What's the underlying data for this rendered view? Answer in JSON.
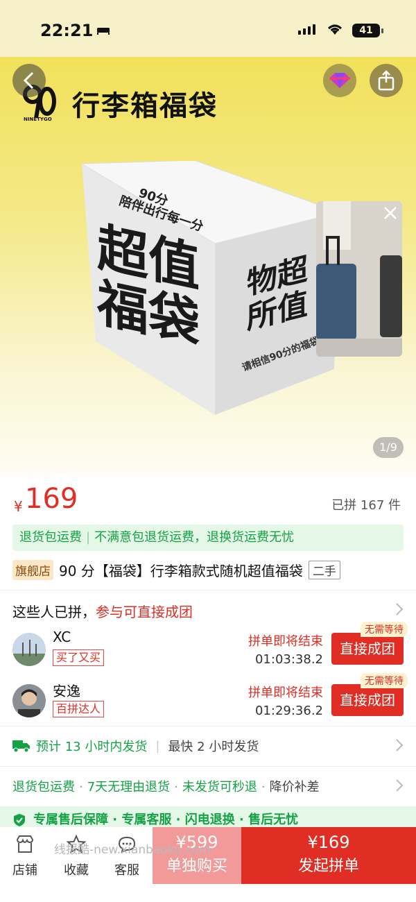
{
  "status_bar": {
    "time": "22:21",
    "battery": "41"
  },
  "hero": {
    "logo_text": "NINETYGO",
    "banner_title": "行李箱福袋",
    "cube_line1": "90分",
    "cube_line2": "陪伴出行每一分",
    "cube_big_1": "超值",
    "cube_big_2": "福袋",
    "cube_side_1": "物超",
    "cube_side_2": "所值",
    "cube_small": "请相信90分的福袋",
    "image_counter": "1/9"
  },
  "product": {
    "currency": "¥",
    "price": "169",
    "sold": "已拼 167 件",
    "return_banner": [
      "退货包运费",
      "不满意包退货运费，退换货运费无忧"
    ],
    "store_tag": "旗舰店",
    "title": "90 分【福袋】行李箱款式随机超值福袋",
    "condition_tag": "二手"
  },
  "group": {
    "heading": "这些人已拼，",
    "heading_red": "参与可直接成团",
    "members": [
      {
        "name": "XC",
        "tag": "买了又买",
        "status": "拼单即将结束",
        "timer": "01:03:38.2",
        "badge": "无需等待",
        "button": "直接成团"
      },
      {
        "name": "安逸",
        "tag": "百拼达人",
        "status": "拼单即将结束",
        "timer": "01:29:36.2",
        "badge": "无需等待",
        "button": "直接成团"
      }
    ]
  },
  "shipping": {
    "estimate": "预计 13 小时内发货",
    "fastest": "最快 2 小时发货"
  },
  "services": {
    "items": [
      "退货包运费",
      "7天无理由退货",
      "未发货可秒退"
    ],
    "extra": "降价补差"
  },
  "guarantee": {
    "text": "专属售后保障 · 专属客服 · 闪电退换 · 售后无忧"
  },
  "bottom_bar": {
    "nav": [
      "店铺",
      "收藏",
      "客服"
    ],
    "watermark": "线报酷-new.xianbaoku.com",
    "solo_price": "¥599",
    "solo_label": "单独购买",
    "group_price": "¥169",
    "group_label": "发起拼单"
  },
  "colors": {
    "accent_red": "#e02e24",
    "green": "#15a246",
    "banner_yellow": "#f1e15a"
  }
}
